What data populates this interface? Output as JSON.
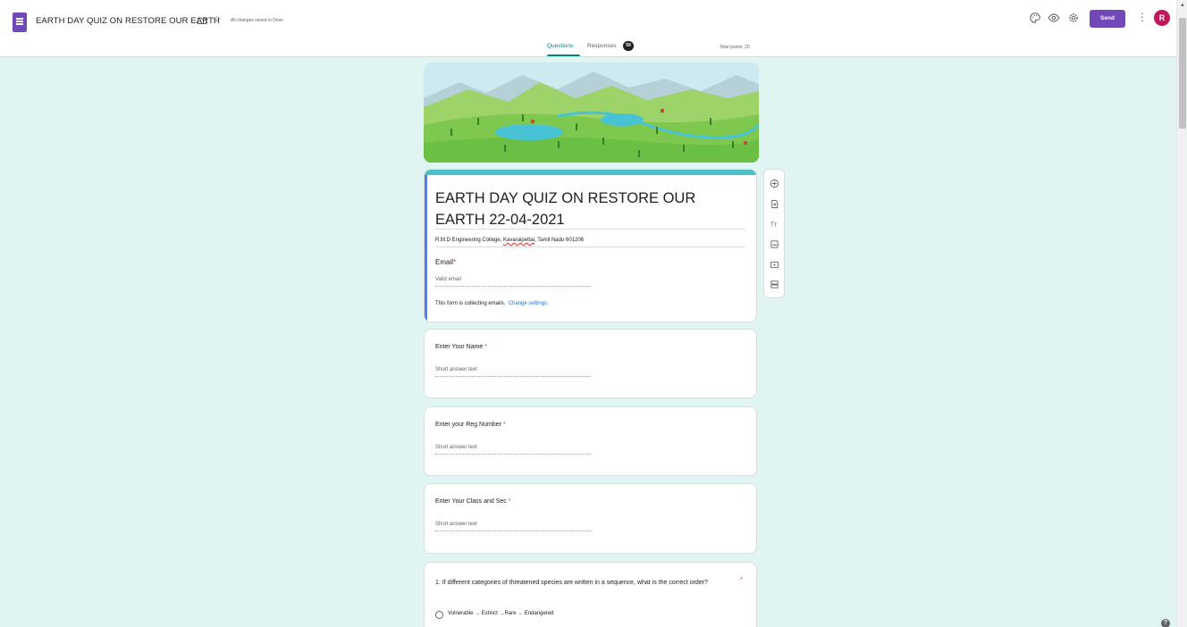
{
  "header": {
    "title": "EARTH DAY QUIZ ON RESTORE OUR EARTH",
    "saved_status": "All changes saved in Drive",
    "send_label": "Send",
    "avatar_letter": "R"
  },
  "tabs": {
    "questions": "Questions",
    "responses": "Responses",
    "responses_count": "59",
    "total_points": "Total points: 20"
  },
  "form": {
    "title": "EARTH DAY QUIZ ON RESTORE OUR EARTH 22-04-2021",
    "description_start": "R.M.D Engineering College, ",
    "description_underlined": "Kavaraipettai",
    "description_end": ", Tamil Nadu 601206",
    "email_label": "Email",
    "email_placeholder": "Valid email",
    "collecting_text": "This form is collecting emails.",
    "change_settings": "Change settings"
  },
  "questions": [
    {
      "label": "Enter Your Name",
      "placeholder": "Short answer text"
    },
    {
      "label": "Enter your Reg Number",
      "placeholder": "Short answer text"
    },
    {
      "label": "Enter Your Class and Sec",
      "placeholder": "Short answer text"
    },
    {
      "label": "1. If different categories of threatened species are written in a sequence, what is the correct order?",
      "options": [
        "Vulnerable → Extinct →Rare → Endangered"
      ]
    }
  ],
  "required_mark": "*",
  "icons": {
    "toolbar": [
      "add-question-icon",
      "import-questions-icon",
      "add-title-icon",
      "add-image-icon",
      "add-video-icon",
      "add-section-icon"
    ],
    "header": [
      "forms-logo-icon",
      "folder-icon",
      "star-icon",
      "palette-icon",
      "eye-icon",
      "gear-icon",
      "more-vert-icon"
    ]
  },
  "colors": {
    "brand": "#7248b9",
    "background": "#e0f5f2",
    "accent": "#008577",
    "title_strip": "#4ec0c9",
    "required": "#d93025",
    "link": "#1a73e8"
  }
}
